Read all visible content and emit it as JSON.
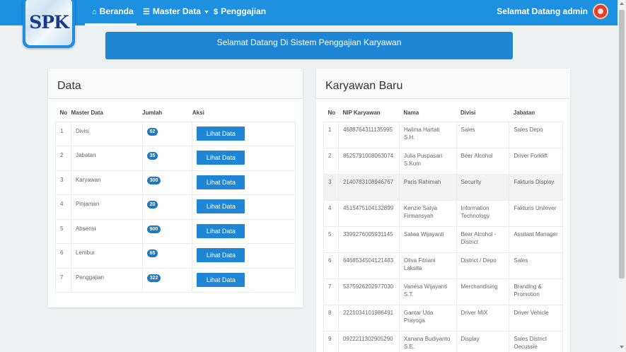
{
  "nav": {
    "logo_text": "SPK",
    "home": "Beranda",
    "master": "Master Data",
    "payroll": "Penggajian",
    "welcome": "Selamat Datang admin"
  },
  "banner": "Selamat Datang Di Sistem Penggajian Karyawan",
  "data_panel": {
    "title": "Data",
    "headers": [
      "No",
      "Master Data",
      "Jumlah",
      "Aksi"
    ],
    "button_label": "Lihat Data",
    "rows": [
      {
        "no": "1",
        "name": "Divisi",
        "count": "62"
      },
      {
        "no": "2",
        "name": "Jabatan",
        "count": "35"
      },
      {
        "no": "3",
        "name": "Karyawan",
        "count": "300"
      },
      {
        "no": "4",
        "name": "Pinjaman",
        "count": "20"
      },
      {
        "no": "5",
        "name": "Absensi",
        "count": "900"
      },
      {
        "no": "6",
        "name": "Lembur",
        "count": "65"
      },
      {
        "no": "7",
        "name": "Penggajian",
        "count": "322"
      }
    ]
  },
  "new_employees": {
    "title": "Karyawan Baru",
    "headers": [
      "No",
      "NIP Karyawan",
      "Nama",
      "Divisi",
      "Jabatan"
    ],
    "rows": [
      {
        "no": "1",
        "nip": "4688764311135995",
        "nama": "Halima Hartati S.H.",
        "divisi": "Sales",
        "jabatan": "Sales Depo"
      },
      {
        "no": "2",
        "nip": "8525791008063074",
        "nama": "Julia Puspasari S.Kom",
        "divisi": "Beer Alcohol",
        "jabatan": "Driver Forklift"
      },
      {
        "no": "3",
        "nip": "2140783108946767",
        "nama": "Paris Rahimah",
        "divisi": "Security",
        "jabatan": "Fakturis Display"
      },
      {
        "no": "4",
        "nip": "4515475104132899",
        "nama": "Kenzie Satya Firmansyah",
        "divisi": "Information Technology",
        "jabatan": "Fakturis Unilever"
      },
      {
        "no": "5",
        "nip": "3399276005931145",
        "nama": "Salwa Wijayanti",
        "divisi": "Beer Alcohol - District",
        "jabatan": "Assitant Manager"
      },
      {
        "no": "6",
        "nip": "6468534504121483",
        "nama": "Oliva Fitriani Laksita",
        "divisi": "District / Depo",
        "jabatan": "Sales"
      },
      {
        "no": "7",
        "nip": "5375926202977030",
        "nama": "Vanesa Wijayanti S.T.",
        "divisi": "Merchandising",
        "jabatan": "Branding & Promotion"
      },
      {
        "no": "8",
        "nip": "2221034101986491",
        "nama": "Gantar Uda Prayoga",
        "divisi": "Driver MIX",
        "jabatan": "Driver Vehicle"
      },
      {
        "no": "9",
        "nip": "0922211302905290",
        "nama": "Xanana Budiyanto S.E.",
        "divisi": "Display",
        "jabatan": "Sales District Oecussie"
      }
    ]
  }
}
